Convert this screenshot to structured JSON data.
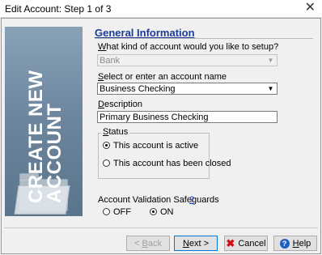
{
  "window": {
    "title": "Edit Account: Step 1 of 3",
    "close_glyph": "✕"
  },
  "banner": {
    "line1": "CREATE NEW",
    "line2": "ACCOUNT",
    "icon": "folder-icon"
  },
  "section": {
    "heading": "General Information"
  },
  "account_kind": {
    "prefix": "W",
    "label_rest": "hat kind of account would you like to setup?",
    "value": "Bank",
    "arrow": "▼"
  },
  "account_name": {
    "prefix": "S",
    "label_rest": "elect or enter an account name",
    "value": "Business Checking",
    "arrow": "▼"
  },
  "description": {
    "prefix": "D",
    "label_rest": "escription",
    "value": "Primary Business Checking"
  },
  "status": {
    "prefix": "S",
    "label_rest": "tatus",
    "options": [
      {
        "label": "This account is active",
        "checked": true
      },
      {
        "label": "This account has been closed",
        "checked": false
      }
    ]
  },
  "safeguards": {
    "label": "Account Validation Safeguards",
    "help_link": "?",
    "off_label": "OFF",
    "on_label": "ON",
    "selected": "ON"
  },
  "buttons": {
    "back_prefix": "< ",
    "back_u": "B",
    "back_rest": "ack",
    "next_u": "N",
    "next_rest": "ext >",
    "cancel_x": "✖",
    "cancel_label": "Cancel",
    "help_icon_glyph": "?",
    "help_u": "H",
    "help_rest": "elp"
  },
  "colors": {
    "heading": "#1e3c96",
    "banner": "#6e879f",
    "cancel_icon": "#d01010",
    "help_icon": "#1f5fbf",
    "focus_border": "#0078d7"
  }
}
